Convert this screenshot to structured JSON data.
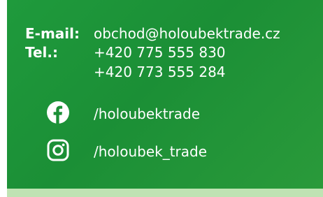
{
  "contact": {
    "email_label": "E-mail:",
    "email_value": "obchod@holoubektrade.cz",
    "phone_label": "Tel.:",
    "phone_1": "+420 775 555 830",
    "phone_2": "+420 773 555 284"
  },
  "social": {
    "facebook_icon": "facebook-icon",
    "facebook_handle": "/holoubektrade",
    "instagram_icon": "instagram-icon",
    "instagram_handle": "/holoubek_trade"
  },
  "colors": {
    "panel_green": "#1b8f36",
    "bottom_strip": "#bfe3b3",
    "text": "#ffffff"
  }
}
